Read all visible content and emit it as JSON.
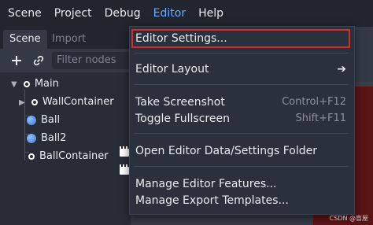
{
  "menubar": {
    "items": [
      "Scene",
      "Project",
      "Debug",
      "Editor",
      "Help"
    ],
    "active_index": 3
  },
  "dock": {
    "tabs": [
      "Scene",
      "Import"
    ],
    "filter_placeholder": "Filter nodes",
    "tree": [
      {
        "label": "Main",
        "icon": "node-ring-icon",
        "has_toggle": true,
        "expanded": true
      },
      {
        "label": "WallContainer",
        "icon": "node-ring-icon",
        "has_toggle": true,
        "expanded": false
      },
      {
        "label": "Ball",
        "icon": "globe-icon",
        "has_scene_icon": true
      },
      {
        "label": "Ball2",
        "icon": "globe-icon",
        "has_scene_icon": true
      },
      {
        "label": "BallContainer",
        "icon": "node-ring-icon"
      }
    ]
  },
  "editor_menu": {
    "items": [
      {
        "label": "Editor Settings...",
        "shortcut": ""
      },
      {
        "label": "Editor Layout",
        "shortcut": "",
        "submenu": true
      },
      {
        "label": "Take Screenshot",
        "shortcut": "Control+F12"
      },
      {
        "label": "Toggle Fullscreen",
        "shortcut": "Shift+F11"
      },
      {
        "label": "Open Editor Data/Settings Folder",
        "shortcut": ""
      },
      {
        "label": "Manage Editor Features...",
        "shortcut": ""
      },
      {
        "label": "Manage Export Templates...",
        "shortcut": ""
      }
    ]
  },
  "watermark": "CSDN @盲屋",
  "colors": {
    "accent": "#6ea8ff",
    "highlight_border": "#d52b2b",
    "menu_bg": "#2b313c",
    "menubar_bg": "#21262e"
  }
}
